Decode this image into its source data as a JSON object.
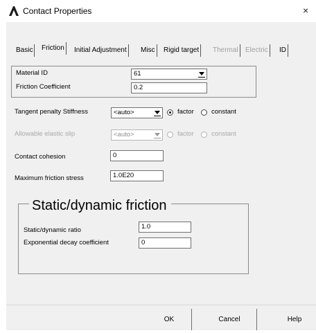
{
  "window": {
    "title": "Contact Properties",
    "close_glyph": "×",
    "app_icon": "ansys-logo-icon",
    "logo_color": "#1b1b1b"
  },
  "tabs": [
    {
      "label": "Basic",
      "active": false,
      "enabled": true
    },
    {
      "label": "Friction",
      "active": true,
      "enabled": true
    },
    {
      "label": "Initial Adjustment",
      "active": false,
      "enabled": true
    },
    {
      "label": "Misc",
      "active": false,
      "enabled": true
    },
    {
      "label": "Rigid target",
      "active": false,
      "enabled": true
    },
    {
      "label": "Thermal",
      "active": false,
      "enabled": false
    },
    {
      "label": "Electric",
      "active": false,
      "enabled": false
    },
    {
      "label": "ID",
      "active": false,
      "enabled": true
    }
  ],
  "friction": {
    "material_id": {
      "label": "Material ID",
      "value": "61"
    },
    "friction_coefficient": {
      "label": "Friction Coefficient",
      "value": "0.2"
    },
    "tangent_penalty": {
      "label": "Tangent penalty Stiffness",
      "value": "<auto>",
      "option_factor": "factor",
      "option_constant": "constant",
      "selected": "factor"
    },
    "allowable_slip": {
      "label": "Allowable elastic slip",
      "value": "<auto>",
      "option_factor": "factor",
      "option_constant": "constant",
      "enabled": false
    },
    "contact_cohesion": {
      "label": "Contact cohesion",
      "value": "0"
    },
    "max_friction_stress": {
      "label": "Maximum friction stress",
      "value": "1.0E20"
    },
    "static_dynamic": {
      "title": "Static/dynamic friction",
      "ratio": {
        "label": "Static/dynamic ratio",
        "value": "1.0"
      },
      "decay": {
        "label": "Exponential decay coefficient",
        "value": "0"
      }
    }
  },
  "buttons": {
    "ok": "OK",
    "cancel": "Cancel",
    "help": "Help"
  },
  "colors": {
    "dialog_bg": "#f0f0f0",
    "disabled_text": "#a0a0a0"
  }
}
